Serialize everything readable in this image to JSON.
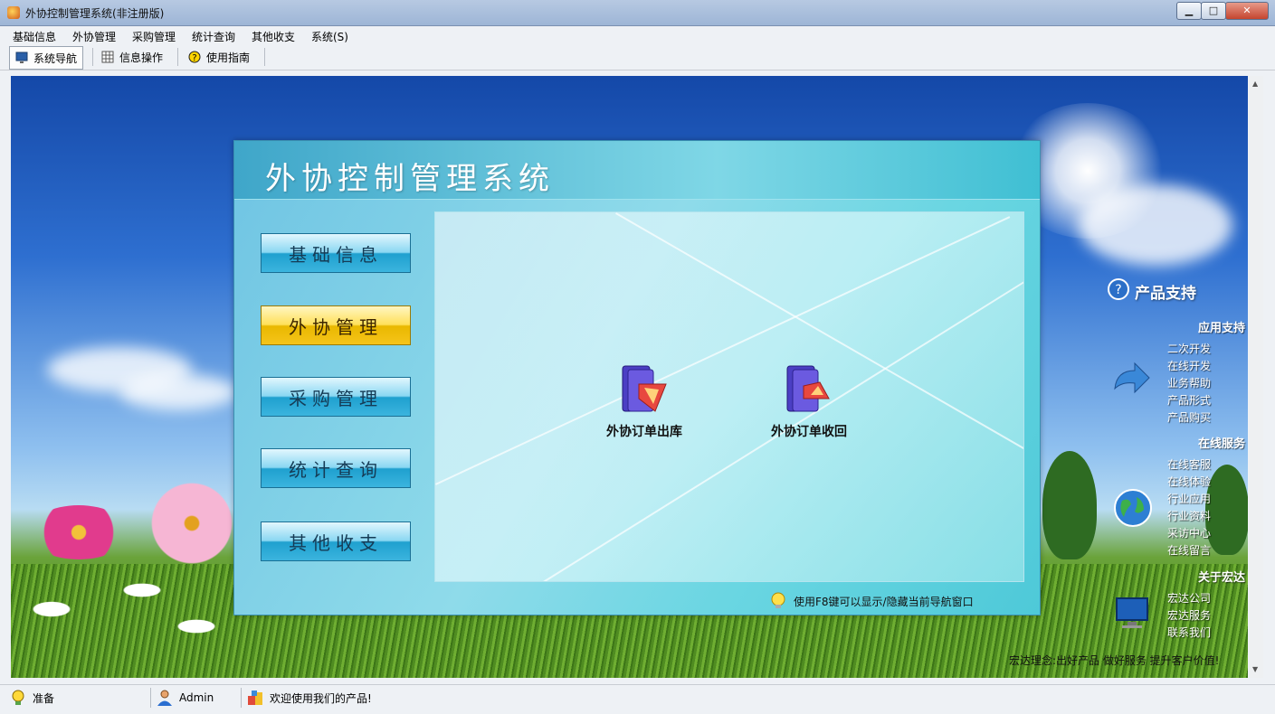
{
  "window": {
    "title": "外协控制管理系统(非注册版)",
    "controls": {
      "minimize": "▁",
      "maximize": "□",
      "close": "✕"
    }
  },
  "menu": [
    "基础信息",
    "外协管理",
    "采购管理",
    "统计查询",
    "其他收支",
    "系统(S)"
  ],
  "toolbar": {
    "nav": "系统导航",
    "info": "信息操作",
    "help": "使用指南"
  },
  "panel": {
    "title": "外协控制管理系统",
    "nav_buttons": [
      "基础信息",
      "外协管理",
      "采购管理",
      "统计查询",
      "其他收支"
    ],
    "active_nav": "外协管理",
    "functions": [
      "外协订单出库",
      "外协订单收回"
    ],
    "tip": "使用F8键可以显示/隐藏当前导航窗口"
  },
  "support": {
    "title": "产品支持",
    "sections": [
      {
        "heading": "应用支持",
        "links": [
          "二次开发",
          "在线开发",
          "业务帮助",
          "产品形式",
          "产品购买"
        ]
      },
      {
        "heading": "在线服务",
        "links": [
          "在线客服",
          "在线体验",
          "行业应用",
          "行业资料",
          "采访中心",
          "在线留言"
        ]
      },
      {
        "heading": "关于宏达",
        "links": [
          "宏达公司",
          "宏达服务",
          "联系我们"
        ]
      }
    ],
    "slogan": "宏达理念:出好产品 做好服务 提升客户价值!"
  },
  "status": {
    "state": "准备",
    "user": "Admin",
    "message": "欢迎使用我们的产品!"
  },
  "colors": {
    "accent": "#1fa0cf",
    "active": "#f5c41a",
    "title_text": "#ffffff"
  },
  "icons": [
    "app-icon",
    "monitor-icon",
    "grid-icon",
    "help-circle-icon",
    "folder-out-icon",
    "folder-in-icon",
    "bulb-icon",
    "question-icon",
    "arrow-icon",
    "globe-icon",
    "monitor-support-icon",
    "status-ready-icon",
    "user-icon",
    "product-icon"
  ]
}
